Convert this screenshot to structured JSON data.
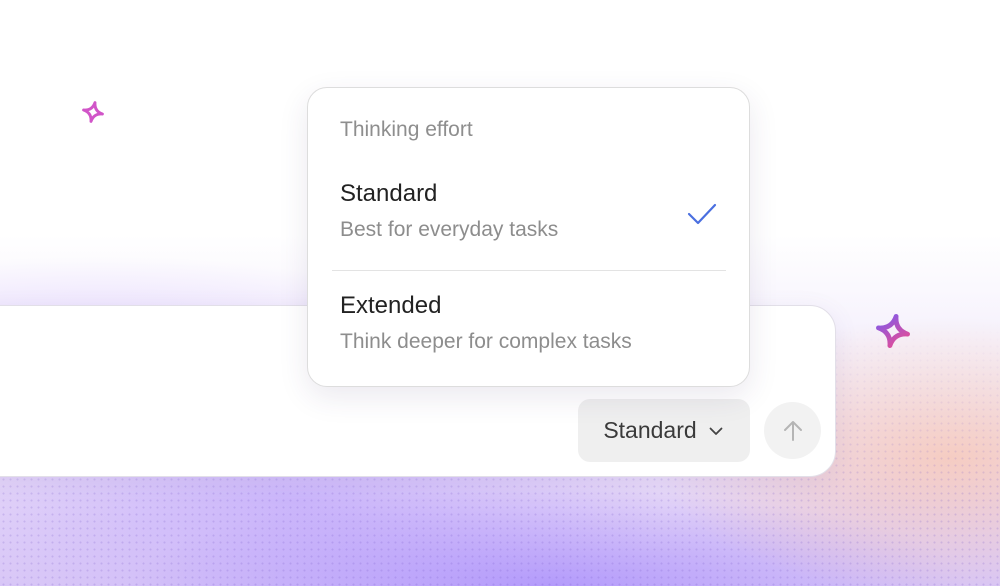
{
  "menu": {
    "heading": "Thinking effort",
    "options": [
      {
        "title": "Standard",
        "description": "Best for everyday tasks",
        "selected": true
      },
      {
        "title": "Extended",
        "description": "Think deeper for complex tasks",
        "selected": false
      }
    ]
  },
  "composer": {
    "effort_button_label": "Standard",
    "send_icon": "arrow-up-icon"
  },
  "colors": {
    "check": "#4a6fe0",
    "sparkle_left": "#d155c8",
    "sparkle_right_start": "#7a5cf0",
    "sparkle_right_end": "#f04a8c"
  }
}
